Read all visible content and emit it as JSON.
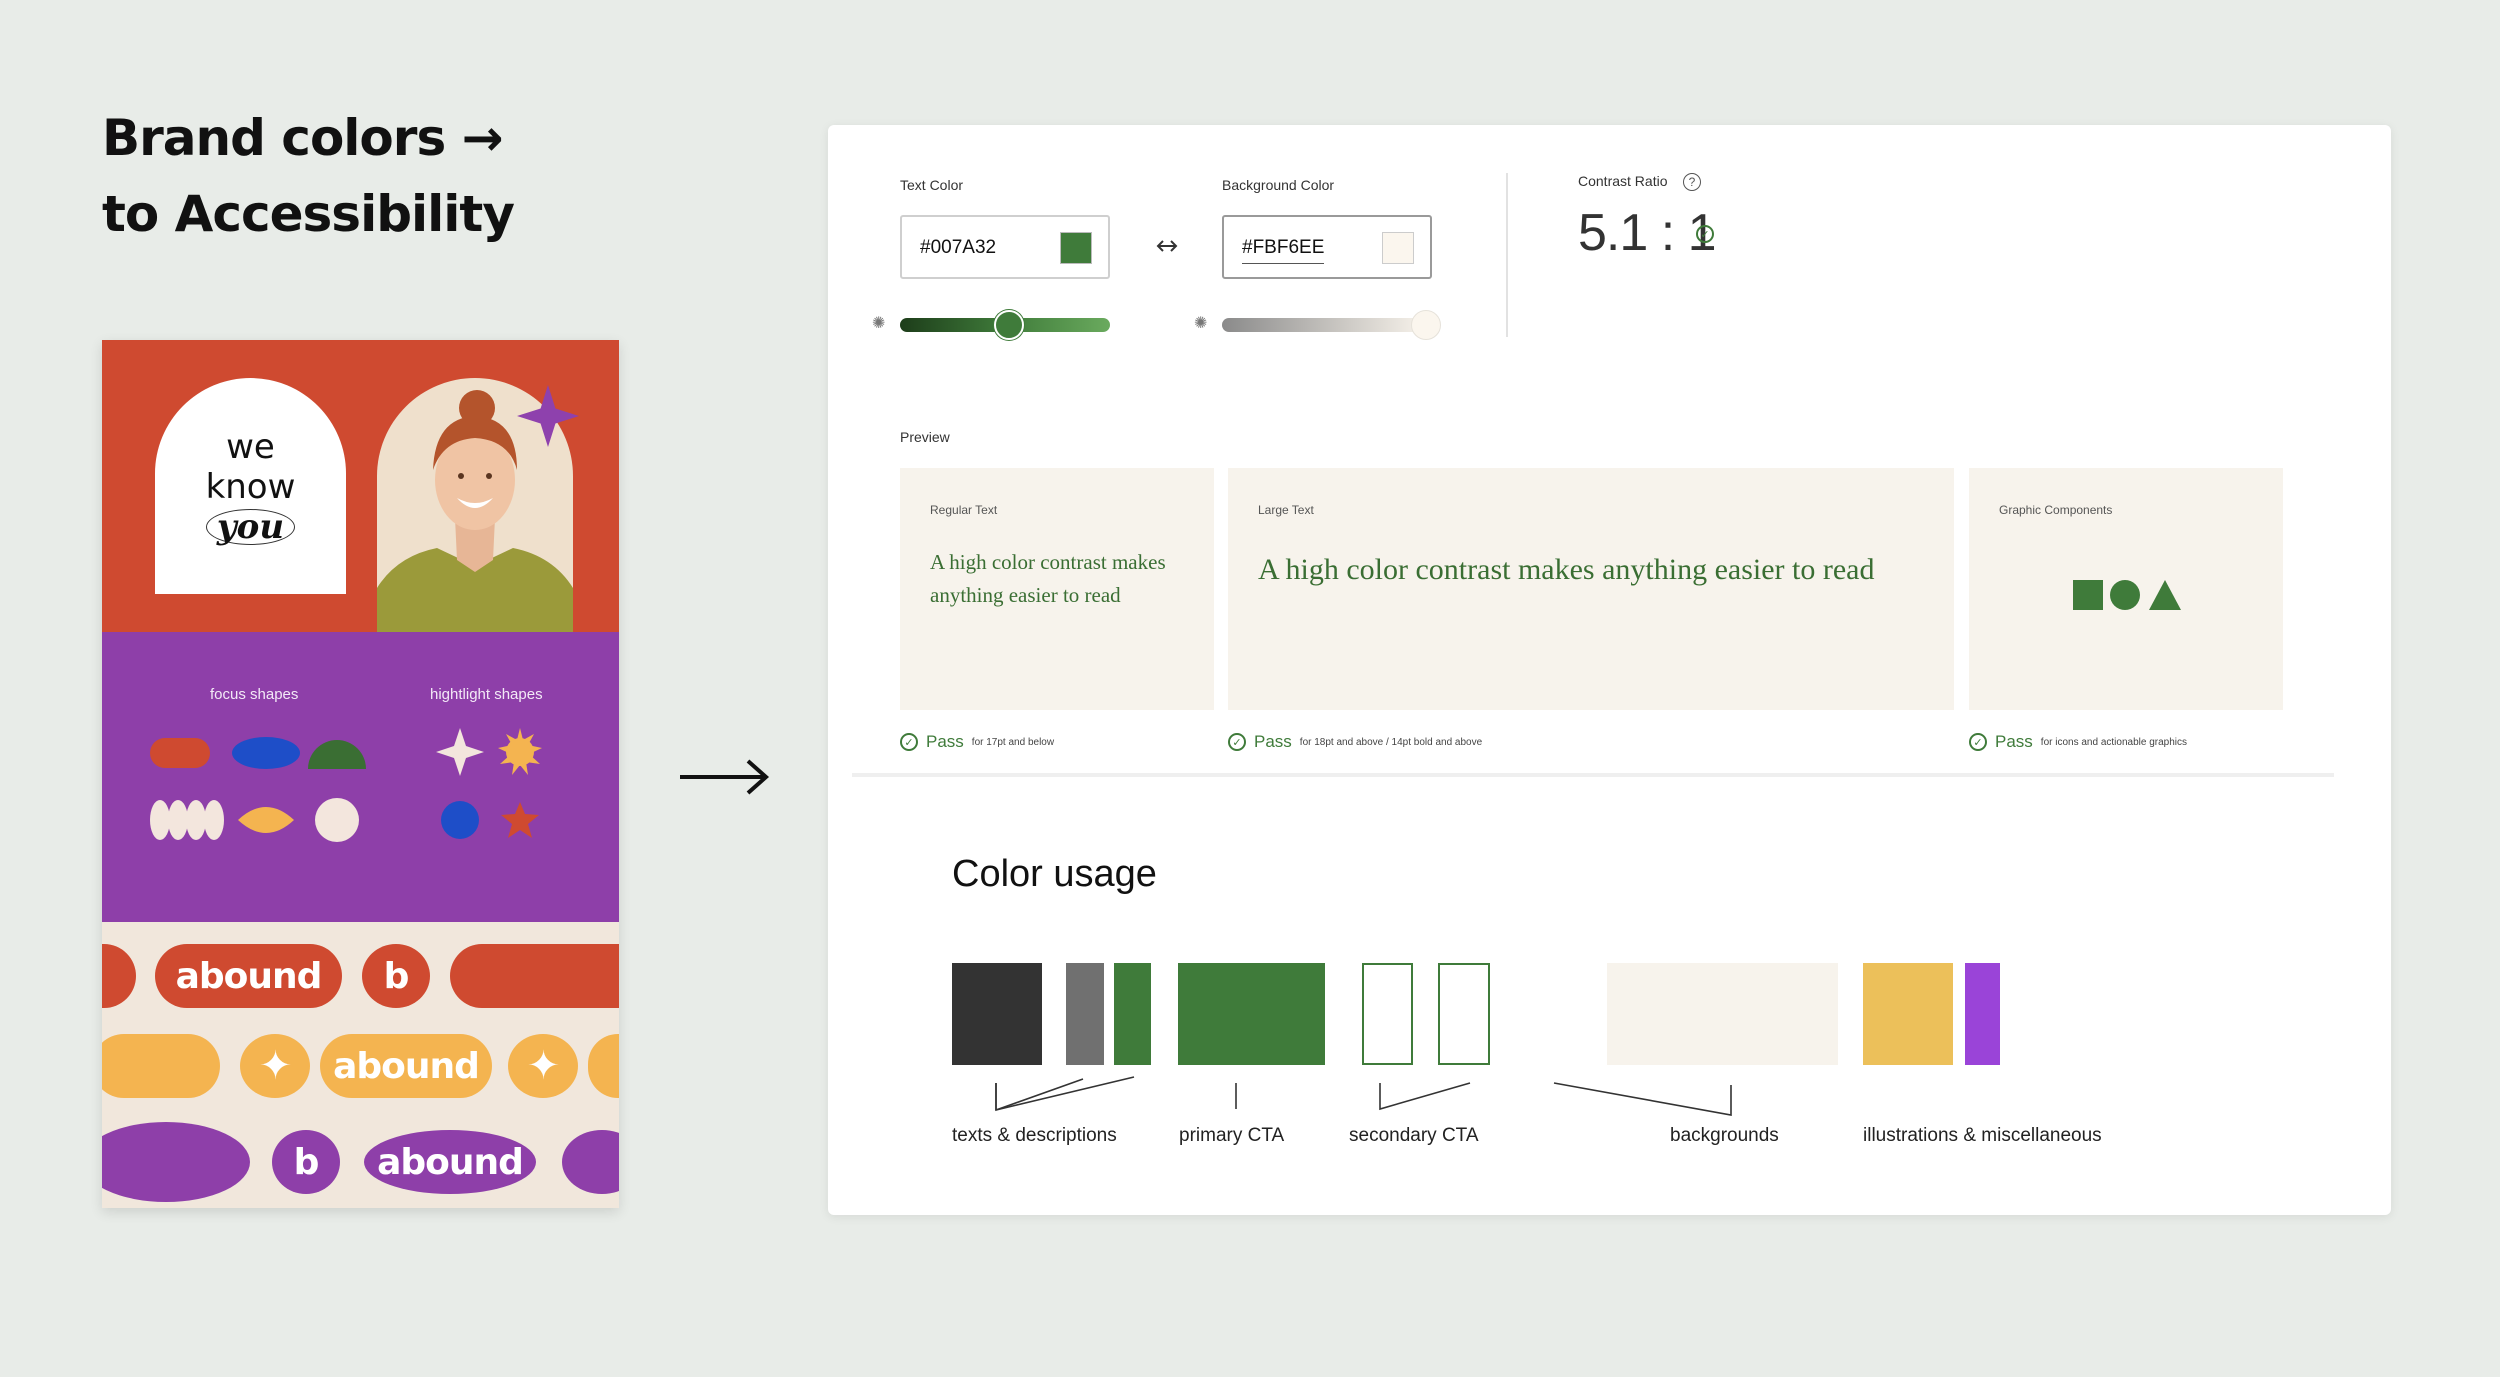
{
  "headline": {
    "line1": "Brand colors →",
    "line2": "to Accessibility"
  },
  "poster": {
    "we": "we",
    "know": "know",
    "you": "you",
    "focus_label": "focus shapes",
    "highlight_label": "hightlight shapes",
    "brand_word": "abound",
    "brand_letter": "b"
  },
  "tool": {
    "text_color_label": "Text Color",
    "text_color_value": "#007A32",
    "bg_color_label": "Background Color",
    "bg_color_value": "#FBF6EE",
    "swap_icon": "swap-arrows-icon",
    "contrast_label": "Contrast Ratio",
    "help_icon": "question-icon",
    "help_glyph": "?",
    "contrast_value": "5.1 : 1",
    "text_slider_level": 0.52,
    "bg_slider_level": 0.97,
    "preview_label": "Preview",
    "cards": [
      {
        "title": "Regular Text",
        "body": "A high color contrast makes anything easier to read",
        "pass": "Pass",
        "note": "for 17pt and below"
      },
      {
        "title": "Large Text",
        "body": "A high color contrast makes anything easier to read",
        "pass": "Pass",
        "note": "for 18pt and above / 14pt bold and above"
      },
      {
        "title": "Graphic Components",
        "pass": "Pass",
        "note": "for icons and actionable graphics"
      }
    ]
  },
  "color_usage": {
    "title": "Color usage",
    "labels": [
      "texts & descriptions",
      "primary CTA",
      "secondary CTA",
      "backgrounds",
      "illustrations & miscellaneous"
    ]
  },
  "colors": {
    "accent_green": "#3f7b3a",
    "red": "#cf4a30",
    "purple": "#8e3fa9",
    "yellow": "#f4b450",
    "cream": "#f7f3ec",
    "dark": "#333333",
    "grey": "#707070",
    "gold": "#ecc05a",
    "violet": "#9a44d8"
  }
}
